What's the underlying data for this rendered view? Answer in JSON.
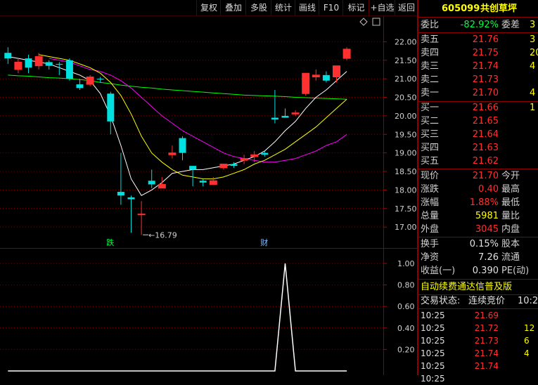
{
  "toolbar": {
    "buttons": [
      "复权",
      "叠加",
      "多股",
      "统计",
      "画线",
      "F10",
      "标记",
      "+自选",
      "返回"
    ]
  },
  "header": {
    "code": "605099",
    "name": "共创草坪"
  },
  "colors": {
    "up": "#ff3030",
    "down": "#00e0e0",
    "ma5": "#ffffff",
    "ma10": "#ffff00",
    "ma20": "#ff00ff",
    "ma60": "#00ff00"
  },
  "quote": {
    "weibi_label": "委比",
    "weibi_value": "-82.92%",
    "weicha_label": "委差",
    "weicha_value": "3",
    "asks": [
      {
        "label": "卖五",
        "price": "21.76",
        "vol": "3"
      },
      {
        "label": "卖四",
        "price": "21.75",
        "vol": "20"
      },
      {
        "label": "卖三",
        "price": "21.74",
        "vol": "4"
      },
      {
        "label": "卖二",
        "price": "21.73",
        "vol": ""
      },
      {
        "label": "卖一",
        "price": "21.70",
        "vol": "4"
      }
    ],
    "bids": [
      {
        "label": "买一",
        "price": "21.66",
        "vol": "1"
      },
      {
        "label": "买二",
        "price": "21.65",
        "vol": ""
      },
      {
        "label": "买三",
        "price": "21.64",
        "vol": ""
      },
      {
        "label": "买四",
        "price": "21.63",
        "vol": ""
      },
      {
        "label": "买五",
        "price": "21.62",
        "vol": ""
      }
    ],
    "stats": [
      {
        "l1": "现价",
        "v1": "21.70",
        "c1": "red",
        "l2": "今开"
      },
      {
        "l1": "涨跌",
        "v1": "0.40",
        "c1": "red",
        "l2": "最高"
      },
      {
        "l1": "涨幅",
        "v1": "1.88%",
        "c1": "red",
        "l2": "最低"
      },
      {
        "l1": "总量",
        "v1": "5981",
        "c1": "yellow",
        "l2": "量比"
      },
      {
        "l1": "外盘",
        "v1": "3045",
        "c1": "red",
        "l2": "内盘"
      }
    ],
    "fin": [
      {
        "l1": "换手",
        "v1": "0.15%",
        "l2": "股本"
      },
      {
        "l1": "净资",
        "v1": "7.26",
        "l2": "流通"
      },
      {
        "l1": "收益(一)",
        "v1": "0.390",
        "l2": "PE(动)"
      }
    ],
    "promo": "自动续费通达信普及版",
    "status_label": "交易状态:",
    "status_value": "连续竞价",
    "status_time": "10:2"
  },
  "ticks": [
    {
      "time": "10:25",
      "price": "21.69",
      "vol": ""
    },
    {
      "time": "10:25",
      "price": "21.72",
      "vol": "12"
    },
    {
      "time": "10:25",
      "price": "21.73",
      "vol": "6"
    },
    {
      "time": "10:25",
      "price": "21.74",
      "vol": "4"
    },
    {
      "time": "10:25",
      "price": "21.74",
      "vol": ""
    },
    {
      "time": "10:25",
      "price": "",
      "vol": ""
    }
  ],
  "chart_data": [
    {
      "type": "candlestick",
      "yticks": [
        "22.00",
        "21.50",
        "21.00",
        "20.50",
        "20.00",
        "19.50",
        "19.00",
        "18.50",
        "18.00",
        "17.50",
        "17.00"
      ],
      "ylim": [
        16.7,
        22.5
      ],
      "low_annotation": "16.79",
      "markers": [
        {
          "text": "跌",
          "index": 10,
          "color": "#00ff40"
        },
        {
          "text": "财",
          "index": 25,
          "color": "#7fbfff"
        }
      ],
      "candles": [
        {
          "o": 21.7,
          "h": 21.85,
          "c": 21.55,
          "l": 21.4
        },
        {
          "o": 21.25,
          "h": 21.55,
          "c": 21.45,
          "l": 21.15
        },
        {
          "o": 21.55,
          "h": 21.65,
          "c": 21.3,
          "l": 21.15
        },
        {
          "o": 21.35,
          "h": 21.7,
          "c": 21.6,
          "l": 21.25
        },
        {
          "o": 21.45,
          "h": 21.5,
          "c": 21.35,
          "l": 21.25
        },
        {
          "o": 21.4,
          "h": 21.45,
          "c": 21.38,
          "l": 21.1
        },
        {
          "o": 21.5,
          "h": 21.55,
          "c": 21.0,
          "l": 20.95
        },
        {
          "o": 20.85,
          "h": 21.0,
          "c": 20.75,
          "l": 20.7
        },
        {
          "o": 20.85,
          "h": 21.1,
          "c": 21.05,
          "l": 20.8
        },
        {
          "o": 21.0,
          "h": 21.05,
          "c": 20.98,
          "l": 20.9
        },
        {
          "o": 20.6,
          "h": 20.65,
          "c": 19.85,
          "l": 19.5
        },
        {
          "o": 17.95,
          "h": 19.0,
          "c": 17.85,
          "l": 17.6
        },
        {
          "o": 17.8,
          "h": 17.85,
          "c": 17.75,
          "l": 16.85
        },
        {
          "o": 17.35,
          "h": 17.7,
          "c": 17.35,
          "l": 16.79
        },
        {
          "o": 18.25,
          "h": 18.55,
          "c": 18.15,
          "l": 18.05
        },
        {
          "o": 18.05,
          "h": 18.35,
          "c": 18.15,
          "l": 18.05
        },
        {
          "o": 18.95,
          "h": 19.2,
          "c": 19.0,
          "l": 18.85
        },
        {
          "o": 19.4,
          "h": 19.45,
          "c": 19.0,
          "l": 18.8
        },
        {
          "o": 18.65,
          "h": 18.65,
          "c": 18.55,
          "l": 18.1
        },
        {
          "o": 18.25,
          "h": 18.3,
          "c": 18.2,
          "l": 18.1
        },
        {
          "o": 18.15,
          "h": 18.35,
          "c": 18.25,
          "l": 18.15
        },
        {
          "o": 18.6,
          "h": 18.7,
          "c": 18.7,
          "l": 18.55
        },
        {
          "o": 18.7,
          "h": 18.75,
          "c": 18.65,
          "l": 18.6
        },
        {
          "o": 18.8,
          "h": 18.95,
          "c": 18.85,
          "l": 18.7
        },
        {
          "o": 18.9,
          "h": 19.05,
          "c": 18.95,
          "l": 18.75
        },
        {
          "o": 19.0,
          "h": 19.05,
          "c": 18.95,
          "l": 18.9
        },
        {
          "o": 19.95,
          "h": 20.7,
          "c": 19.9,
          "l": 19.8
        },
        {
          "o": 20.0,
          "h": 20.2,
          "c": 19.95,
          "l": 19.95
        },
        {
          "o": 20.05,
          "h": 20.15,
          "c": 20.08,
          "l": 20.0
        },
        {
          "o": 20.6,
          "h": 21.05,
          "c": 21.15,
          "l": 20.55
        },
        {
          "o": 21.05,
          "h": 21.25,
          "c": 21.1,
          "l": 20.95
        },
        {
          "o": 21.1,
          "h": 21.2,
          "c": 20.95,
          "l": 20.9
        },
        {
          "o": 21.05,
          "h": 21.1,
          "c": 21.35,
          "l": 20.9
        },
        {
          "o": 21.55,
          "h": 21.85,
          "c": 21.8,
          "l": 21.5
        }
      ],
      "ma5": [
        21.6,
        21.55,
        21.5,
        21.45,
        21.4,
        21.3,
        21.2,
        21.1,
        20.95,
        20.6,
        20.0,
        19.2,
        18.3,
        17.85,
        18.0,
        18.2,
        18.45,
        18.5,
        18.55,
        18.55,
        18.6,
        18.65,
        18.7,
        18.8,
        18.9,
        19.05,
        19.3,
        19.6,
        19.85,
        20.2,
        20.5,
        20.7,
        20.95,
        21.2
      ],
      "ma10": [
        null,
        null,
        null,
        21.65,
        21.6,
        21.55,
        21.5,
        21.4,
        21.3,
        21.15,
        20.9,
        20.55,
        20.05,
        19.45,
        19.0,
        18.75,
        18.55,
        18.4,
        18.35,
        18.3,
        18.3,
        18.35,
        18.45,
        18.55,
        18.7,
        18.8,
        18.95,
        19.1,
        19.3,
        19.5,
        19.7,
        19.95,
        20.2,
        20.45
      ],
      "ma20": [
        null,
        null,
        null,
        null,
        21.55,
        21.5,
        21.45,
        21.35,
        21.25,
        21.2,
        21.1,
        20.95,
        20.75,
        20.5,
        20.25,
        20.0,
        19.8,
        19.6,
        19.45,
        19.3,
        19.15,
        19.0,
        18.9,
        18.85,
        18.8,
        18.75,
        18.75,
        18.8,
        18.85,
        18.95,
        19.05,
        19.2,
        19.3,
        19.5
      ],
      "ma60": [
        21.1,
        21.08,
        21.07,
        21.05,
        21.03,
        21.02,
        21.0,
        20.98,
        20.95,
        20.9,
        20.87,
        20.83,
        20.8,
        20.77,
        20.75,
        20.72,
        20.7,
        20.68,
        20.66,
        20.64,
        20.62,
        20.6,
        20.58,
        20.56,
        20.55,
        20.54,
        20.53,
        20.52,
        20.5,
        20.49,
        20.48,
        20.47,
        20.46,
        20.45
      ]
    },
    {
      "type": "line",
      "yticks": [
        "1.00",
        "0.80",
        "0.60",
        "0.40",
        "0.20"
      ],
      "ylim": [
        0,
        1.1
      ],
      "values": [
        0,
        0,
        0,
        0,
        0,
        0,
        0,
        0,
        0,
        0,
        0,
        0,
        0,
        0,
        0,
        0,
        0,
        0,
        0,
        0,
        0,
        0,
        0,
        0,
        0,
        0,
        0,
        1,
        0,
        0,
        0,
        0,
        0,
        0
      ]
    }
  ]
}
